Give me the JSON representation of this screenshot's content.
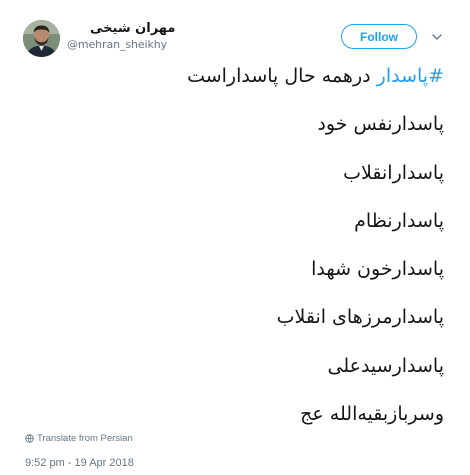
{
  "author": {
    "display_name": "مهران شیخی",
    "handle": "@mehran_sheikhy",
    "avatar_icon": "user-avatar"
  },
  "follow_button": {
    "label": "Follow"
  },
  "menu": {
    "icon": "chevron-down-icon"
  },
  "tweet": {
    "hashtag": "#پاسدار",
    "first_line_rest": " درهمه حال پاسداراست",
    "lines": [
      "پاسدارنفس خود",
      "پاسدارانقلاب",
      "پاسدارنظام",
      "پاسدارخون شهدا",
      "پاسدارمرزهای انقلاب",
      "پاسدارسیدعلی",
      "وسربازبقیه‌الله عج"
    ]
  },
  "translate": {
    "icon": "globe-icon",
    "label": "Translate from Persian"
  },
  "timestamp": "9:52 pm - 19 Apr 2018",
  "colors": {
    "accent": "#1da1f2",
    "text": "#14171a",
    "muted": "#657786"
  }
}
